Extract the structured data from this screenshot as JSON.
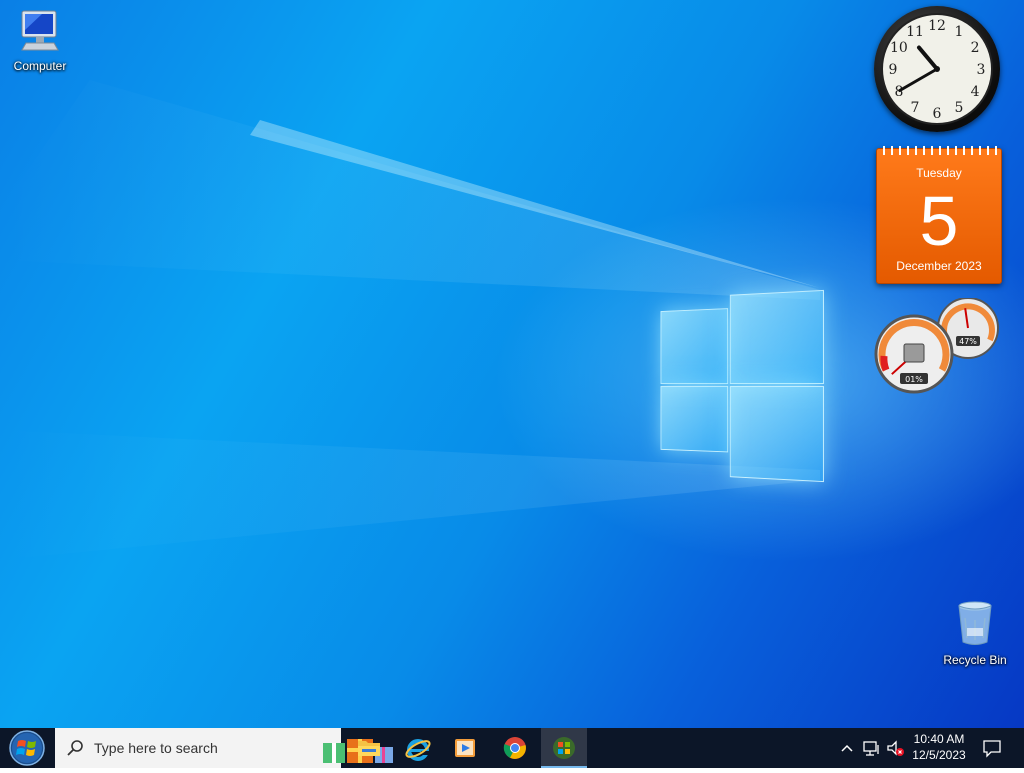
{
  "desktop": {
    "icons": [
      {
        "label": "Computer",
        "icon": "computer-icon"
      },
      {
        "label": "Recycle Bin",
        "icon": "recycle-bin-icon"
      }
    ]
  },
  "gadgets": {
    "clock": {
      "numerals": [
        "12",
        "1",
        "2",
        "3",
        "4",
        "5",
        "6",
        "7",
        "8",
        "9",
        "10",
        "11"
      ],
      "hour": 10,
      "minute": 40
    },
    "calendar": {
      "weekday": "Tuesday",
      "day": "5",
      "month_year": "December 2023",
      "color": "#e45a00"
    },
    "cpu_meter": {
      "cpu_label": "01%",
      "memory_label": "47%",
      "cpu_percent": 1,
      "memory_percent": 47
    }
  },
  "taskbar": {
    "search_placeholder": "Type here to search",
    "apps": [
      {
        "name": "File Explorer",
        "icon": "folder-icon"
      },
      {
        "name": "Internet Explorer",
        "icon": "internet-explorer-icon"
      },
      {
        "name": "Media Player",
        "icon": "media-player-icon"
      },
      {
        "name": "Google Chrome",
        "icon": "chrome-icon"
      },
      {
        "name": "Gadgets",
        "icon": "windows-flag-icon"
      }
    ],
    "clock": {
      "time": "10:40 AM",
      "date": "12/5/2023"
    },
    "tray": [
      "chevron-up-icon",
      "network-icon",
      "volume-muted-icon"
    ]
  },
  "colors": {
    "accent": "#0078d7",
    "taskbar": "#0c1628",
    "calendar": "#e45a00"
  }
}
